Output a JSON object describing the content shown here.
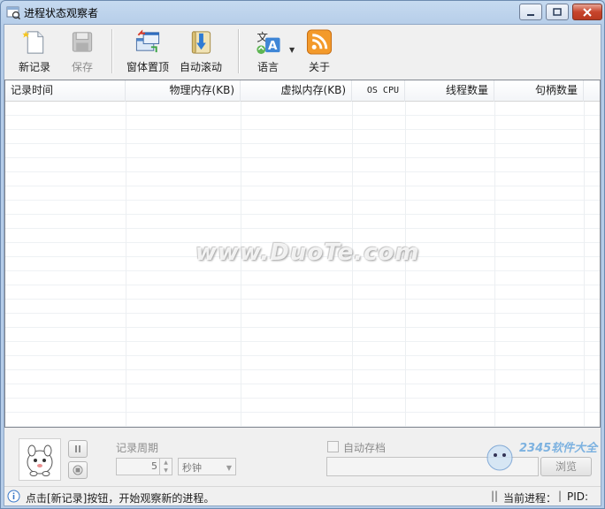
{
  "window": {
    "title": "进程状态观察者"
  },
  "toolbar": {
    "new_record": "新记录",
    "save": "保存",
    "topmost": "窗体置顶",
    "auto_scroll": "自动滚动",
    "language": "语言",
    "about": "关于"
  },
  "table": {
    "columns": [
      "记录时间",
      "物理内存(KB)",
      "虚拟内存(KB)",
      "OS CPU",
      "线程数量",
      "句柄数量"
    ]
  },
  "watermark": "www.DuoTe.com",
  "controls": {
    "period_label": "记录周期",
    "period_value": "5",
    "period_unit": "秒钟",
    "autosave_label": "自动存档",
    "browse_label": "浏览"
  },
  "brand": {
    "logo_text": "2345软件大全"
  },
  "statusbar": {
    "message": "点击[新记录]按钮，开始观察新的进程。",
    "current_process_label": "当前进程：",
    "pid_label": "PID:"
  },
  "colors": {
    "titlebar": "#c6daf0",
    "close_button": "#c7452c",
    "about_icon": "#f39a2b",
    "info_icon": "#3a78c8"
  }
}
